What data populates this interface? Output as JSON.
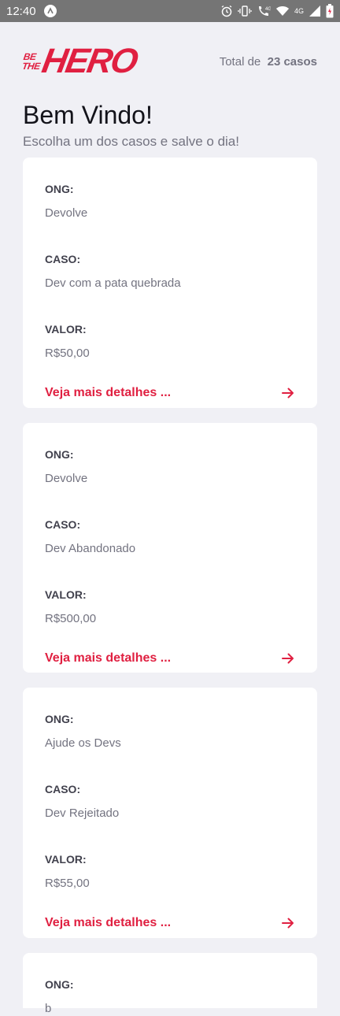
{
  "status_bar": {
    "time": "12:40",
    "network_label": "4G",
    "icons": [
      "app-notification-icon",
      "alarm-icon",
      "vibrate-icon",
      "wifi-call-icon",
      "wifi-icon",
      "signal-icon",
      "battery-icon"
    ]
  },
  "header": {
    "logo_small_line1": "BE",
    "logo_small_line2": "THE",
    "logo_big": "HERO",
    "total_prefix": "Total de",
    "total_count": "23 casos"
  },
  "title": "Bem Vindo!",
  "subtitle": "Escolha um dos casos e salve o dia!",
  "labels": {
    "ong": "ONG:",
    "caso": "CASO:",
    "valor": "VALOR:",
    "details": "Veja mais detalhes ..."
  },
  "incidents": [
    {
      "ong": "Devolve",
      "caso": "Dev com a pata quebrada",
      "valor": "R$50,00"
    },
    {
      "ong": "Devolve",
      "caso": "Dev Abandonado",
      "valor": "R$500,00"
    },
    {
      "ong": "Ajude os Devs",
      "caso": "Dev Rejeitado",
      "valor": "R$55,00"
    },
    {
      "ong": "b",
      "caso": "",
      "valor": ""
    }
  ],
  "colors": {
    "brand": "#e02041",
    "background": "#f0f0f5",
    "text_dark": "#41414d",
    "text_muted": "#737380"
  }
}
